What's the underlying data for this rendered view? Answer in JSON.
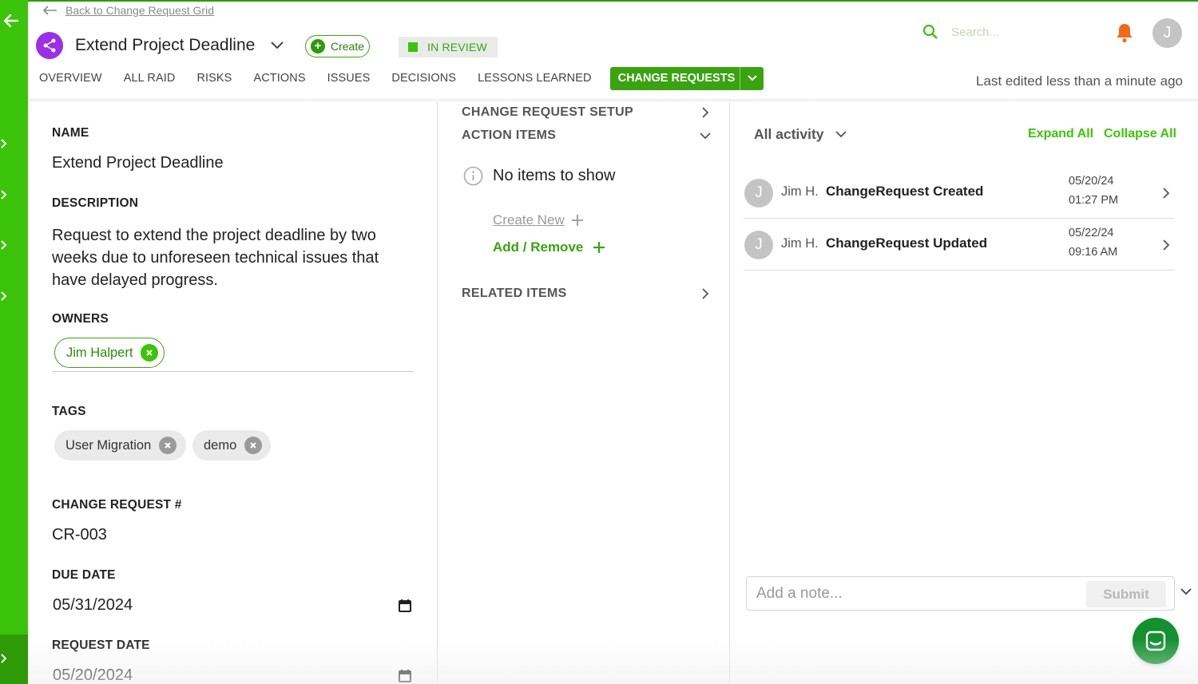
{
  "nav": {
    "back_label": "Back to Change Request Grid"
  },
  "header": {
    "title": "Extend Project Deadline",
    "create_label": "Create",
    "status_label": "IN REVIEW",
    "search_placeholder": "Search...",
    "avatar_initial": "J",
    "last_edited": "Last edited less than a minute ago"
  },
  "tabs": [
    "OVERVIEW",
    "ALL RAID",
    "RISKS",
    "ACTIONS",
    "ISSUES",
    "DECISIONS",
    "LESSONS LEARNED"
  ],
  "active_tab": "CHANGE REQUESTS",
  "fields": {
    "name_label": "NAME",
    "name_value": "Extend Project Deadline",
    "description_label": "DESCRIPTION",
    "description_value": "Request to extend the project deadline by two weeks due to unforeseen technical issues that have delayed progress.",
    "owners_label": "OWNERS",
    "owners": [
      "Jim Halpert"
    ],
    "tags_label": "TAGS",
    "tags": [
      "User Migration",
      "demo"
    ],
    "cr_number_label": "CHANGE REQUEST #",
    "cr_number_value": "CR-003",
    "due_date_label": "DUE DATE",
    "due_date_value": "05/31/2024",
    "request_date_label": "REQUEST DATE",
    "request_date_value": "05/20/2024"
  },
  "middle": {
    "setup_label": "CHANGE REQUEST SETUP",
    "action_items_label": "ACTION ITEMS",
    "no_items": "No items to show",
    "create_new": "Create New",
    "add_remove": "Add / Remove",
    "related_label": "RELATED ITEMS"
  },
  "activity": {
    "filter_label": "All activity",
    "expand_all": "Expand All",
    "collapse_all": "Collapse All",
    "items": [
      {
        "avatar": "J",
        "user": "Jim H.",
        "action": "ChangeRequest Created",
        "date": "05/20/24",
        "time": "01:27 PM"
      },
      {
        "avatar": "J",
        "user": "Jim H.",
        "action": "ChangeRequest Updated",
        "date": "05/22/24",
        "time": "09:16 AM"
      }
    ],
    "note_placeholder": "Add a note...",
    "submit_label": "Submit"
  },
  "colors": {
    "brand_green": "#3cc40a",
    "dark_green": "#2e9a08",
    "project_icon": "#9b30e6",
    "bell": "#f06a1a",
    "chat": "#13902f"
  },
  "icons": [
    "back-arrow-icon",
    "share-network-icon",
    "chevron-down-icon",
    "plus-circle-icon",
    "search-icon",
    "bell-icon",
    "info-icon",
    "plus-icon",
    "chevron-right-icon",
    "calendar-icon",
    "close-circle-icon",
    "chat-icon"
  ]
}
